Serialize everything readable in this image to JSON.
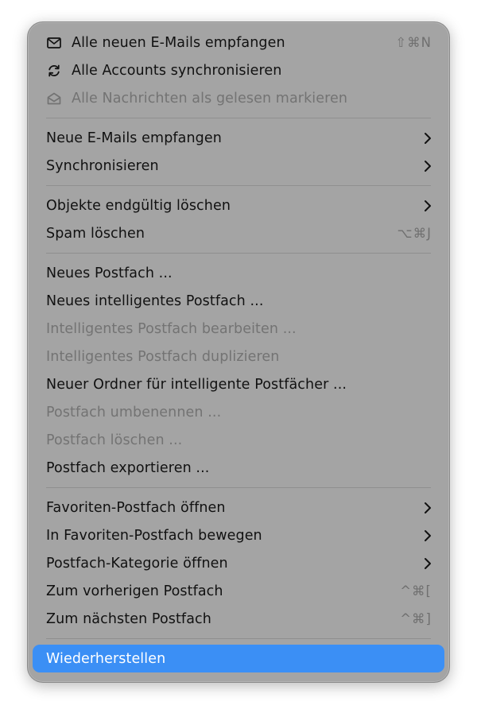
{
  "menu": {
    "section1": [
      {
        "label": "Alle neuen E-Mails empfangen",
        "icon": "envelope-icon",
        "shortcut": "⇧⌘N",
        "enabled": true
      },
      {
        "label": "Alle Accounts synchronisieren",
        "icon": "sync-icon",
        "shortcut": "",
        "enabled": true
      },
      {
        "label": "Alle Nachrichten als gelesen markieren",
        "icon": "open-envelope-icon",
        "shortcut": "",
        "enabled": false
      }
    ],
    "section2": [
      {
        "label": "Neue E-Mails empfangen",
        "submenu": true,
        "enabled": true
      },
      {
        "label": "Synchronisieren",
        "submenu": true,
        "enabled": true
      }
    ],
    "section3": [
      {
        "label": "Objekte endgültig löschen",
        "submenu": true,
        "enabled": true
      },
      {
        "label": "Spam löschen",
        "shortcut": "⌥⌘J",
        "enabled": true
      }
    ],
    "section4": [
      {
        "label": "Neues Postfach ...",
        "enabled": true
      },
      {
        "label": "Neues intelligentes Postfach ...",
        "enabled": true
      },
      {
        "label": "Intelligentes Postfach bearbeiten ...",
        "enabled": false
      },
      {
        "label": "Intelligentes Postfach duplizieren",
        "enabled": false
      },
      {
        "label": "Neuer Ordner für intelligente Postfächer ...",
        "enabled": true
      },
      {
        "label": "Postfach umbenennen ...",
        "enabled": false
      },
      {
        "label": "Postfach löschen ...",
        "enabled": false
      },
      {
        "label": "Postfach exportieren ...",
        "enabled": true
      }
    ],
    "section5": [
      {
        "label": "Favoriten-Postfach öffnen",
        "submenu": true,
        "enabled": true
      },
      {
        "label": "In Favoriten-Postfach bewegen",
        "submenu": true,
        "enabled": true
      },
      {
        "label": "Postfach-Kategorie öffnen",
        "submenu": true,
        "enabled": true
      },
      {
        "label": "Zum vorherigen Postfach",
        "shortcut": "^⌘[",
        "enabled": true
      },
      {
        "label": "Zum nächsten Postfach",
        "shortcut": "^⌘]",
        "enabled": true
      }
    ],
    "section6": [
      {
        "label": "Wiederherstellen",
        "enabled": true,
        "selected": true
      }
    ]
  },
  "colors": {
    "menu_background": "#a4a4a4",
    "selection": "#3b8ff5",
    "disabled_text": "#737373",
    "shortcut_text": "#6f6f6f"
  }
}
